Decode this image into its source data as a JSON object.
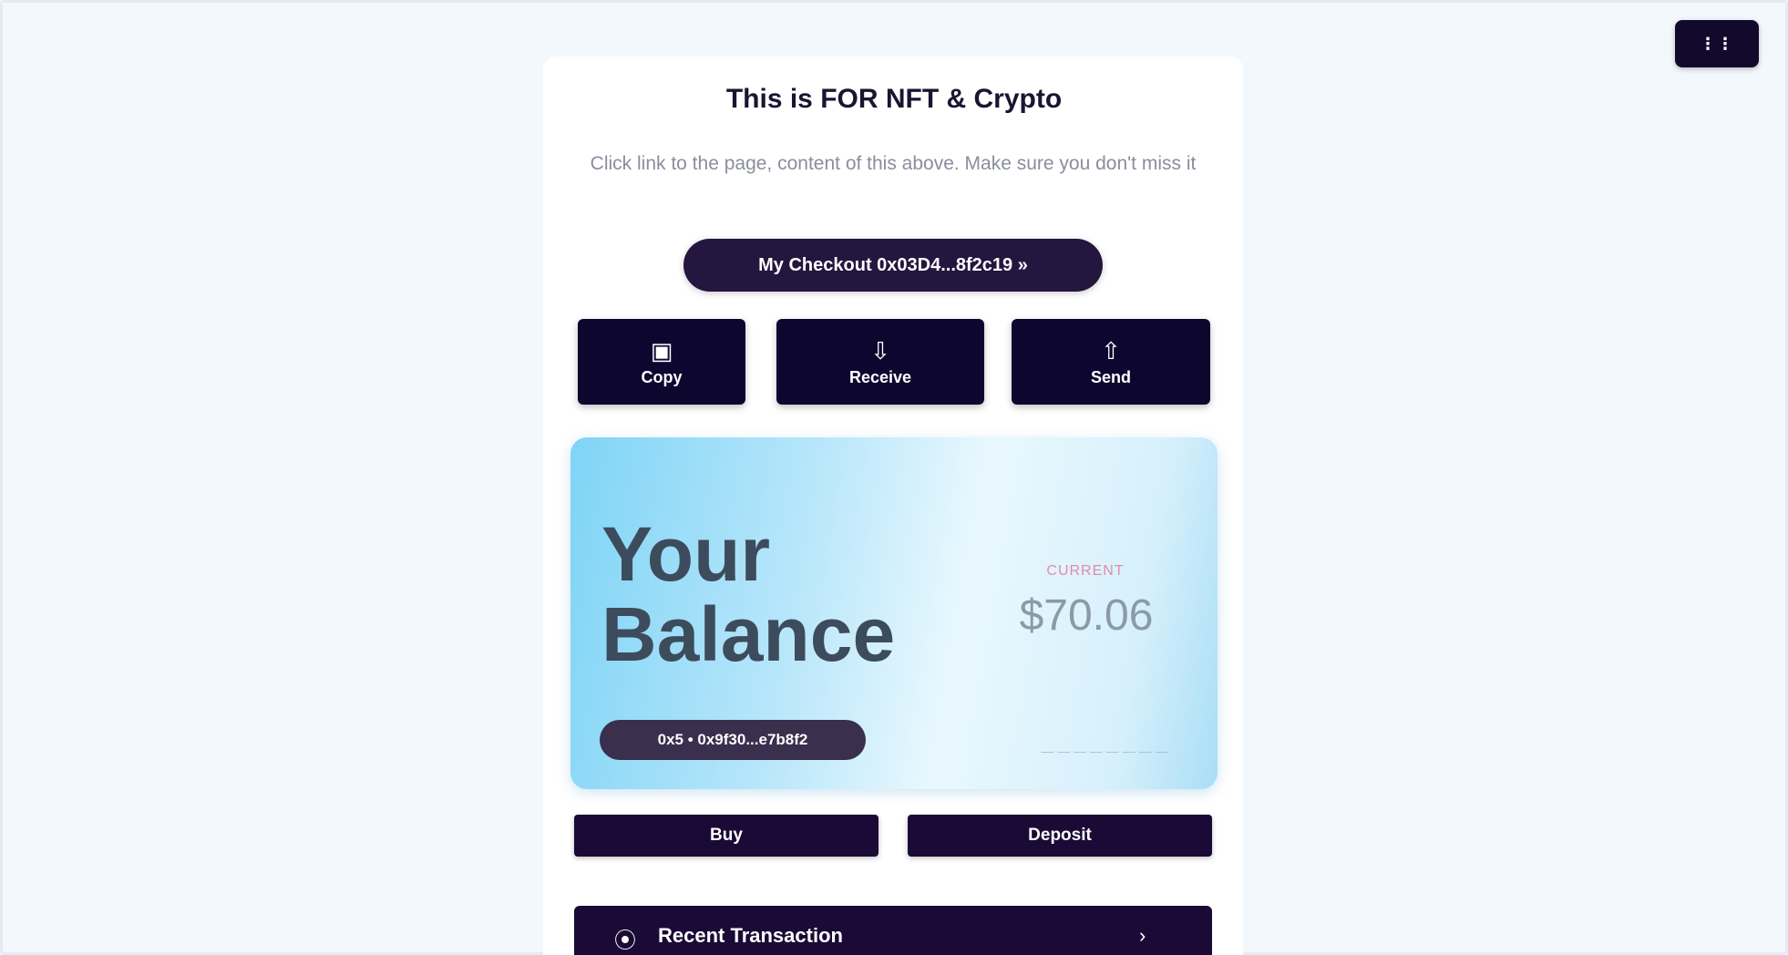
{
  "corner_button": {
    "label": "⋮⋮",
    "icon": "grid-icon"
  },
  "panel": {
    "title": "This is FOR NFT & Crypto",
    "subtitle": "Click link to the page, content of this above. Make sure you don't miss it",
    "pill_link": "My Checkout 0x03D4...8f2c19 »"
  },
  "actions": [
    {
      "icon": "wallet-icon",
      "glyph": "▣",
      "label": "Copy"
    },
    {
      "icon": "receive-icon",
      "glyph": "⇩",
      "label": "Receive"
    },
    {
      "icon": "send-icon",
      "glyph": "⇧",
      "label": "Send"
    }
  ],
  "balance_card": {
    "title_line1": "Your",
    "title_line2": "Balance",
    "label": "CURRENT",
    "amount": "$70.06",
    "address_pill": "0x5 • 0x9f30...e7b8f2",
    "footer": "— — — — — — — —"
  },
  "bar_buttons": [
    {
      "label": "Buy"
    },
    {
      "label": "Deposit"
    }
  ],
  "section": {
    "icon": "chart-icon",
    "glyph": "⦿",
    "title": "Recent Transaction",
    "arrow": "›"
  },
  "colors": {
    "page_bg": "#f3f8fd",
    "dark_button": "#0d0730",
    "card_gradient_start": "#7fd4f6",
    "card_gradient_end": "#a9def6"
  }
}
